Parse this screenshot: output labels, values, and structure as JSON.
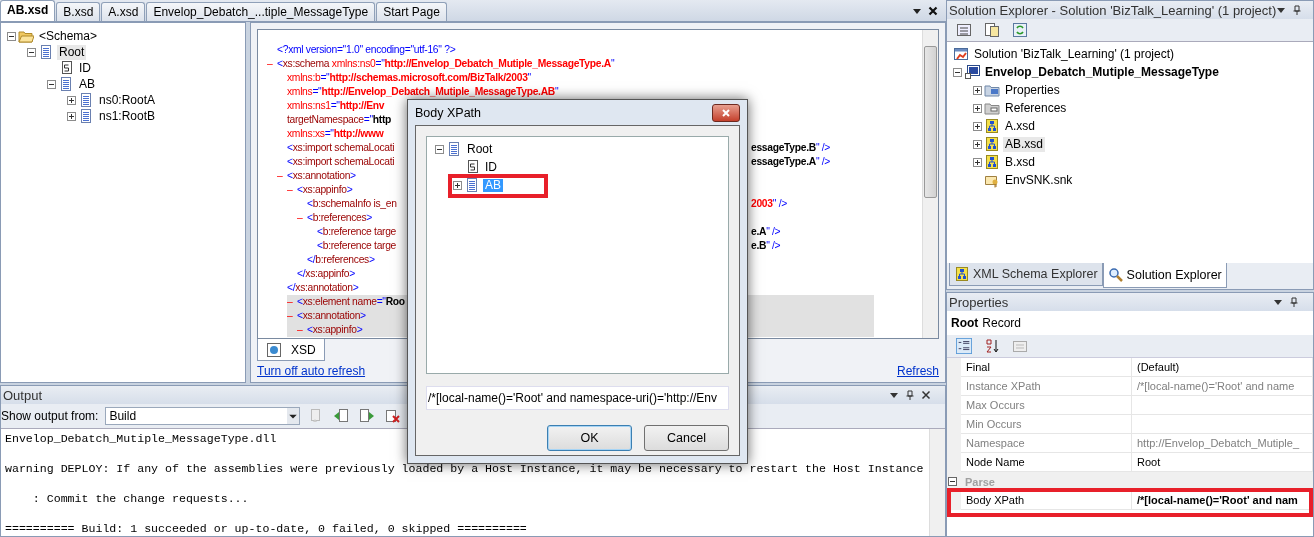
{
  "document_tabs": [
    {
      "label": "AB.xsd",
      "selected": true
    },
    {
      "label": "B.xsd",
      "selected": false
    },
    {
      "label": "A.xsd",
      "selected": false
    },
    {
      "label": "Envelop_Debatch_...tiple_MessageType",
      "selected": false
    },
    {
      "label": "Start Page",
      "selected": false
    }
  ],
  "schema_tree": [
    {
      "label": "<Schema>",
      "kind": "folder",
      "expanded": true,
      "selected": false,
      "children": [
        {
          "label": "Root",
          "kind": "record",
          "expanded": true,
          "selected": true,
          "children": [
            {
              "label": "ID",
              "kind": "field",
              "selected": false
            },
            {
              "label": "AB",
              "kind": "record",
              "expanded": true,
              "selected": false,
              "children": [
                {
                  "label": "ns0:RootA",
                  "kind": "record",
                  "expanded": false,
                  "selected": false
                },
                {
                  "label": "ns1:RootB",
                  "kind": "record",
                  "expanded": false,
                  "selected": false
                }
              ]
            }
          ]
        }
      ]
    }
  ],
  "xml_view": {
    "lines": [
      {
        "highlighted": false,
        "parts": [
          {
            "kind": "p",
            "text": "<?xml version=\"1.0\" encoding=\"utf-16\" ?>"
          }
        ]
      },
      {
        "toggle": "–",
        "highlighted": false,
        "parts": [
          {
            "kind": "p",
            "text": "<"
          },
          {
            "kind": "tag",
            "text": "xs:schema"
          },
          {
            "kind": "nsattr",
            "text": " xmlns:ns0"
          },
          {
            "kind": "p",
            "text": "=\""
          },
          {
            "kind": "nsval",
            "text": "http://Envelop_Debatch_Mutiple_MessageType.A"
          },
          {
            "kind": "p",
            "text": "\""
          }
        ],
        "children": [
          {
            "highlighted": false,
            "parts": [
              {
                "kind": "nsattr",
                "text": "xmlns:b"
              },
              {
                "kind": "p",
                "text": "=\""
              },
              {
                "kind": "nsval",
                "text": "http://schemas.microsoft.com/BizTalk/2003"
              },
              {
                "kind": "p",
                "text": "\""
              }
            ]
          },
          {
            "highlighted": false,
            "parts": [
              {
                "kind": "nsattr",
                "text": "xmlns"
              },
              {
                "kind": "p",
                "text": "=\""
              },
              {
                "kind": "nsval",
                "text": "http://Envelop_Debatch_Mutiple_MessageType.AB"
              },
              {
                "kind": "p",
                "text": "\""
              }
            ]
          },
          {
            "highlighted": false,
            "parts": [
              {
                "kind": "nsattr",
                "text": "xmlns:ns1"
              },
              {
                "kind": "p",
                "text": "=\""
              },
              {
                "kind": "nsval",
                "text": "http://Env"
              }
            ]
          },
          {
            "highlighted": false,
            "parts": [
              {
                "kind": "attr",
                "text": "targetNamespace"
              },
              {
                "kind": "p",
                "text": "=\""
              },
              {
                "kind": "val",
                "text": "http"
              }
            ]
          },
          {
            "highlighted": false,
            "parts": [
              {
                "kind": "nsattr",
                "text": "xmlns:xs"
              },
              {
                "kind": "p",
                "text": "=\""
              },
              {
                "kind": "nsval",
                "text": "http://www"
              }
            ]
          },
          {
            "highlighted": false,
            "parts": [
              {
                "kind": "p",
                "text": "<"
              },
              {
                "kind": "tag",
                "text": "xs:import"
              },
              {
                "kind": "attr",
                "text": " schemaLocati"
              }
            ],
            "right": [
              {
                "kind": "val",
                "text": "essageType.B"
              },
              {
                "kind": "p",
                "text": "\" />"
              }
            ]
          },
          {
            "highlighted": false,
            "parts": [
              {
                "kind": "p",
                "text": "<"
              },
              {
                "kind": "tag",
                "text": "xs:import"
              },
              {
                "kind": "attr",
                "text": " schemaLocati"
              }
            ],
            "right": [
              {
                "kind": "val",
                "text": "essageType.A"
              },
              {
                "kind": "p",
                "text": "\" />"
              }
            ]
          },
          {
            "toggle": "–",
            "highlighted": false,
            "parts": [
              {
                "kind": "p",
                "text": "<"
              },
              {
                "kind": "tag",
                "text": "xs:annotation"
              },
              {
                "kind": "p",
                "text": ">"
              }
            ],
            "close": [
              {
                "kind": "p",
                "text": "</"
              },
              {
                "kind": "tag",
                "text": "xs:annotation"
              },
              {
                "kind": "p",
                "text": ">"
              }
            ],
            "children": [
              {
                "toggle": "–",
                "highlighted": false,
                "parts": [
                  {
                    "kind": "p",
                    "text": "<"
                  },
                  {
                    "kind": "tag",
                    "text": "xs:appinfo"
                  },
                  {
                    "kind": "p",
                    "text": ">"
                  }
                ],
                "close": [
                  {
                    "kind": "p",
                    "text": "</"
                  },
                  {
                    "kind": "tag",
                    "text": "xs:appinfo"
                  },
                  {
                    "kind": "p",
                    "text": ">"
                  }
                ],
                "children": [
                  {
                    "highlighted": false,
                    "parts": [
                      {
                        "kind": "p",
                        "text": "<"
                      },
                      {
                        "kind": "tag",
                        "text": "b:schemaInfo"
                      },
                      {
                        "kind": "attr",
                        "text": " is_en"
                      }
                    ],
                    "right": [
                      {
                        "kind": "nsval",
                        "text": "2003"
                      },
                      {
                        "kind": "p",
                        "text": "\" />"
                      }
                    ]
                  },
                  {
                    "toggle": "–",
                    "highlighted": false,
                    "parts": [
                      {
                        "kind": "p",
                        "text": "<"
                      },
                      {
                        "kind": "tag",
                        "text": "b:references"
                      },
                      {
                        "kind": "p",
                        "text": ">"
                      }
                    ],
                    "close": [
                      {
                        "kind": "p",
                        "text": "</"
                      },
                      {
                        "kind": "tag",
                        "text": "b:references"
                      },
                      {
                        "kind": "p",
                        "text": ">"
                      }
                    ],
                    "children": [
                      {
                        "highlighted": false,
                        "parts": [
                          {
                            "kind": "p",
                            "text": "<"
                          },
                          {
                            "kind": "tag",
                            "text": "b:reference"
                          },
                          {
                            "kind": "attr",
                            "text": " targe"
                          }
                        ],
                        "right": [
                          {
                            "kind": "val",
                            "text": "e.A"
                          },
                          {
                            "kind": "p",
                            "text": "\" />"
                          }
                        ]
                      },
                      {
                        "highlighted": false,
                        "parts": [
                          {
                            "kind": "p",
                            "text": "<"
                          },
                          {
                            "kind": "tag",
                            "text": "b:reference"
                          },
                          {
                            "kind": "attr",
                            "text": " targe"
                          }
                        ],
                        "right": [
                          {
                            "kind": "val",
                            "text": "e.B"
                          },
                          {
                            "kind": "p",
                            "text": "\" />"
                          }
                        ]
                      }
                    ]
                  }
                ]
              }
            ]
          },
          {
            "toggle": "–",
            "highlighted": true,
            "parts": [
              {
                "kind": "p",
                "text": "<"
              },
              {
                "kind": "tag",
                "text": "xs:element"
              },
              {
                "kind": "attr",
                "text": " name"
              },
              {
                "kind": "p",
                "text": "=\""
              },
              {
                "kind": "val",
                "text": "Roo"
              }
            ],
            "children": [
              {
                "toggle": "–",
                "highlighted": false,
                "parts": [
                  {
                    "kind": "p",
                    "text": "<"
                  },
                  {
                    "kind": "tag",
                    "text": "xs:annotation"
                  },
                  {
                    "kind": "p",
                    "text": ">"
                  }
                ],
                "children": [
                  {
                    "toggle": "–",
                    "highlighted": false,
                    "parts": [
                      {
                        "kind": "p",
                        "text": "<"
                      },
                      {
                        "kind": "tag",
                        "text": "xs:appinfo"
                      },
                      {
                        "kind": "p",
                        "text": ">"
                      }
                    ]
                  }
                ]
              }
            ]
          }
        ]
      }
    ],
    "view_tabs": [
      {
        "label": "XSD",
        "selected": true
      }
    ],
    "links": [
      "Turn off auto refresh",
      "Refresh"
    ]
  },
  "output": {
    "title": "Output",
    "source_label": "Show output from:",
    "source": "Build",
    "lines": [
      "Envelop_Debatch_Mutiple_MessageType.dll",
      "warning DEPLOY: If any of the assemblies were previously loaded by a Host Instance, it may be necessary to restart the Host Instance",
      "    : Commit the change requests...",
      "========== Build: 1 succeeded or up-to-date, 0 failed, 0 skipped =========="
    ]
  },
  "solution_explorer": {
    "title": "Solution Explorer - Solution 'BizTalk_Learning' (1 project)",
    "tree": [
      {
        "label": "Solution 'BizTalk_Learning' (1 project)",
        "kind": "solution",
        "selected": false,
        "children": [
          {
            "label": "Envelop_Debatch_Mutiple_MessageType",
            "kind": "project",
            "bold": true,
            "expanded": true,
            "selected": false,
            "children": [
              {
                "label": "Properties",
                "kind": "properties",
                "expanded": false,
                "selected": false
              },
              {
                "label": "References",
                "kind": "references",
                "expanded": false,
                "selected": false
              },
              {
                "label": "A.xsd",
                "kind": "schema",
                "expanded": false,
                "selected": false
              },
              {
                "label": "AB.xsd",
                "kind": "schema",
                "expanded": false,
                "selected": true
              },
              {
                "label": "B.xsd",
                "kind": "schema",
                "expanded": false,
                "selected": false
              },
              {
                "label": "EnvSNK.snk",
                "kind": "key",
                "selected": false
              }
            ]
          }
        ]
      }
    ],
    "tabs": [
      {
        "label": "XML Schema Explorer",
        "kind": "schema",
        "selected": false
      },
      {
        "label": "Solution Explorer",
        "kind": "search",
        "selected": true
      }
    ]
  },
  "properties": {
    "title": "Properties",
    "object_name": "Root",
    "object_type": "Record",
    "rows": [
      {
        "kind": "property",
        "name": "Final",
        "value": "(Default)",
        "readonly": false,
        "modified": false,
        "flagged": false
      },
      {
        "kind": "property",
        "name": "Instance XPath",
        "value": "/*[local-name()='Root' and name",
        "readonly": true,
        "modified": false,
        "flagged": false
      },
      {
        "kind": "property",
        "name": "Max Occurs",
        "readonly": true,
        "modified": false,
        "flagged": false
      },
      {
        "kind": "property",
        "name": "Min Occurs",
        "readonly": true,
        "modified": false,
        "flagged": false
      },
      {
        "kind": "property",
        "name": "Namespace",
        "value": "http://Envelop_Debatch_Mutiple_",
        "readonly": true,
        "modified": false,
        "flagged": false
      },
      {
        "kind": "property",
        "name": "Node Name",
        "value": "Root",
        "readonly": false,
        "modified": false,
        "flagged": false
      },
      {
        "kind": "category",
        "name": "Parse",
        "expanded": true
      },
      {
        "kind": "property",
        "name": "Body XPath",
        "value": "/*[local-name()='Root' and nam",
        "readonly": false,
        "modified": true,
        "flagged": true
      }
    ]
  },
  "dialog": {
    "title": "Body XPath",
    "tree": [
      {
        "label": "Root",
        "kind": "record",
        "expanded": true,
        "selected": false,
        "flagged": false,
        "children": [
          {
            "label": "ID",
            "kind": "field",
            "selected": false,
            "flagged": false
          },
          {
            "label": "AB",
            "kind": "record",
            "expanded": false,
            "selected": true,
            "flagged": true
          }
        ]
      }
    ],
    "xpath": "/*[local-name()='Root' and namespace-uri()='http://Env",
    "buttons": [
      {
        "label": "OK",
        "default": true
      },
      {
        "label": "Cancel",
        "default": false
      }
    ]
  }
}
